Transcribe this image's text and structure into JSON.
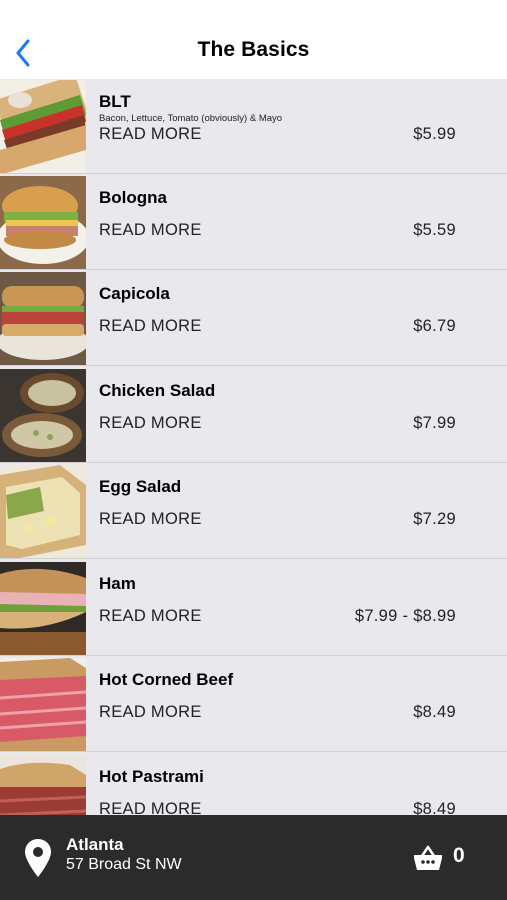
{
  "header": {
    "title": "The Basics",
    "back_icon": "chevron-left-icon"
  },
  "items": [
    {
      "name": "BLT",
      "description": "Bacon, Lettuce, Tomato (obviously) & Mayo",
      "more_label": "READ MORE",
      "price": "$5.99",
      "image": "blt-sandwich"
    },
    {
      "name": "Bologna",
      "description": "",
      "more_label": "READ MORE",
      "price": "$5.59",
      "image": "bologna-sandwich"
    },
    {
      "name": "Capicola",
      "description": "",
      "more_label": "READ MORE",
      "price": "$6.79",
      "image": "capicola-sandwich"
    },
    {
      "name": "Chicken Salad",
      "description": "",
      "more_label": "READ MORE",
      "price": "$7.99",
      "image": "chicken-salad-sandwich"
    },
    {
      "name": "Egg Salad",
      "description": "",
      "more_label": "READ MORE",
      "price": "$7.29",
      "image": "egg-salad-sandwich"
    },
    {
      "name": "Ham",
      "description": "",
      "more_label": "READ MORE",
      "price": "$7.99 - $8.99",
      "image": "ham-sandwich"
    },
    {
      "name": "Hot Corned Beef",
      "description": "",
      "more_label": "READ MORE",
      "price": "$8.49",
      "image": "corned-beef-sandwich"
    },
    {
      "name": "Hot Pastrami",
      "description": "",
      "more_label": "READ MORE",
      "price": "$8.49",
      "image": "pastrami-sandwich"
    }
  ],
  "footer": {
    "location_icon": "map-pin-icon",
    "city": "Atlanta",
    "address": "57 Broad St NW",
    "cart_icon": "basket-icon",
    "cart_count": "0"
  },
  "colors": {
    "accent": "#1a7cf5",
    "list_bg": "#e8e8ed",
    "footer_bg": "#2b2b2b"
  }
}
